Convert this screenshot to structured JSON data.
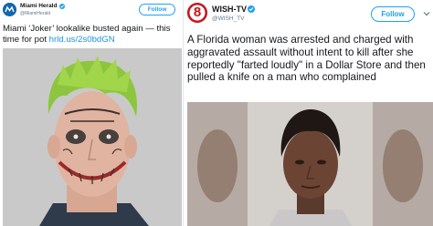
{
  "left_tweet": {
    "account_name": "Miami Herald",
    "handle": "@MiamiHerald",
    "follow_label": "Follow",
    "text_main": "Miami ‘Joker’ lookalike busted again — this time for pot",
    "text_link": "hrld.us/2s0bdGN",
    "avatar_icon": "miami-herald-logo-icon",
    "photo_icon": "joker-mugshot-photo"
  },
  "right_tweet": {
    "account_name": "WISH-TV",
    "handle": "@WISH_TV",
    "follow_label": "Follow",
    "avatar_logo_text": "8",
    "text": "A Florida woman was arrested and charged with aggravated assault without intent to kill after she reportedly \"farted loudly\" in a Dollar Store and then pulled a knife on a man who complained",
    "photo_icon": "woman-mugshot-photo"
  },
  "colors": {
    "twitter_blue": "#1da1f2",
    "link_blue": "#1b95e0",
    "text": "#14171a",
    "secondary": "#657786",
    "wish_red": "#c4161c"
  }
}
